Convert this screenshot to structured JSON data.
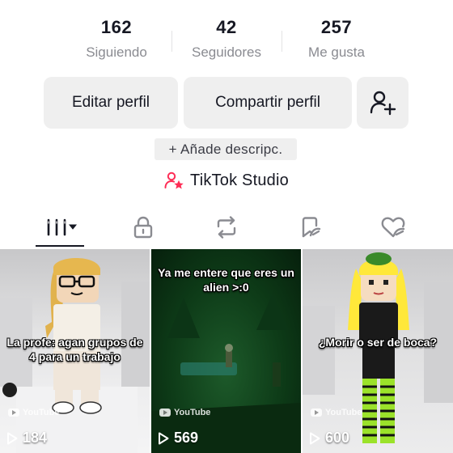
{
  "stats": {
    "following": {
      "count": "162",
      "label": "Siguiendo"
    },
    "followers": {
      "count": "42",
      "label": "Seguidores"
    },
    "likes": {
      "count": "257",
      "label": "Me gusta"
    }
  },
  "actions": {
    "edit_label": "Editar perfil",
    "share_label": "Compartir perfil",
    "add_friend_icon": "add-user-icon"
  },
  "description_button": "+ Añade descripc.",
  "studio_label": "TikTok Studio",
  "tabs": [
    {
      "icon": "grid-icon",
      "selected": true
    },
    {
      "icon": "lock-icon",
      "selected": false
    },
    {
      "icon": "repost-icon",
      "selected": false
    },
    {
      "icon": "bookmark-icon",
      "selected": false
    },
    {
      "icon": "liked-heart-icon",
      "selected": false
    }
  ],
  "videos": [
    {
      "caption": "La profe: agan grupos de 4 para un trabajo",
      "watermark": "YouTube",
      "views": "184"
    },
    {
      "caption": "Ya me entere que eres un alien >:0",
      "watermark": "YouTube",
      "views": "569"
    },
    {
      "caption": "¿Morir o ser de boca?",
      "watermark": "YouTube",
      "views": "600"
    }
  ],
  "colors": {
    "accent": "#fe2c55",
    "button_bg": "#efefef",
    "muted_text": "#8a8b91"
  }
}
